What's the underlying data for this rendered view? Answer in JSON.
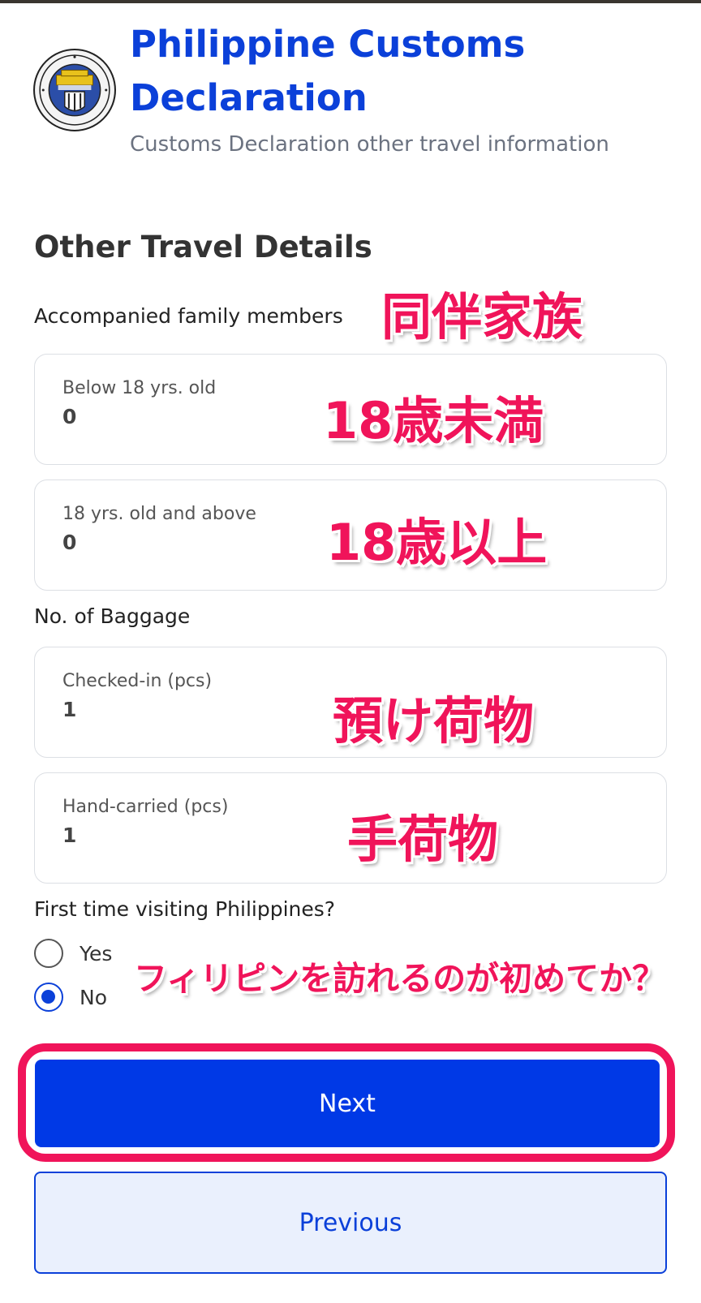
{
  "header": {
    "title": "Philippine Customs Declaration",
    "subtitle": "Customs Declaration other travel information",
    "logo_icon": "bureau-of-customs-seal-icon"
  },
  "section": {
    "title": "Other Travel Details"
  },
  "family": {
    "label": "Accompanied family members",
    "below18": {
      "label": "Below 18 yrs. old",
      "value": "0"
    },
    "above18": {
      "label": "18 yrs. old and above",
      "value": "0"
    }
  },
  "baggage": {
    "label": "No. of Baggage",
    "checked_in": {
      "label": "Checked-in (pcs)",
      "value": "1"
    },
    "hand_carried": {
      "label": "Hand-carried (pcs)",
      "value": "1"
    }
  },
  "first_visit": {
    "label": "First time visiting Philippines?",
    "options": [
      {
        "label": "Yes",
        "selected": false
      },
      {
        "label": "No",
        "selected": true
      }
    ]
  },
  "buttons": {
    "next": "Next",
    "previous": "Previous"
  },
  "annotations": {
    "family": "同伴家族",
    "below18": "18歳未満",
    "above18": "18歳以上",
    "checked_in": "預け荷物",
    "hand_carried": "手荷物",
    "first_visit": "フィリピンを訪れるのが初めてか？"
  },
  "colors": {
    "brand_blue": "#0b40d9",
    "button_blue": "#0039e6",
    "annotation_pink": "#f0145a"
  }
}
